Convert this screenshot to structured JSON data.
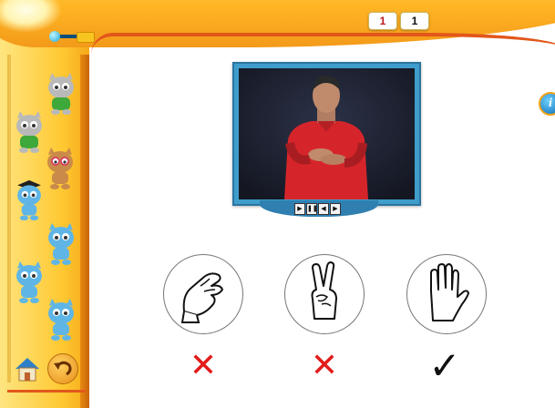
{
  "header": {
    "counters": [
      "1",
      "1"
    ]
  },
  "info_button": {
    "label": "i"
  },
  "sidebar": {
    "creatures": [
      {
        "kind": "grey-cat-green-shirt"
      },
      {
        "kind": "grey-cat-green-shirt"
      },
      {
        "kind": "orange-cat-glasses"
      },
      {
        "kind": "blue-cat-graduation-cap"
      },
      {
        "kind": "blue-cat"
      },
      {
        "kind": "blue-cat"
      },
      {
        "kind": "blue-cat"
      }
    ],
    "home_icon": "home-icon",
    "back_icon": "back-arrow-icon"
  },
  "video": {
    "controls": [
      "play-icon",
      "pause-icon",
      "rewind-icon",
      "forward-icon"
    ]
  },
  "choices": [
    {
      "sign": "hand-sign-pinch",
      "result": "✕",
      "result_icon": "wrong-icon"
    },
    {
      "sign": "hand-sign-v",
      "result": "✕",
      "result_icon": "wrong-icon"
    },
    {
      "sign": "hand-sign-flat",
      "result": "✓",
      "result_icon": "correct-icon"
    }
  ],
  "colors": {
    "accent_orange": "#e2571b",
    "sidebar_yellow": "#ffc832",
    "wrong_red": "#e21b1b",
    "video_blue": "#3f9dcb"
  }
}
